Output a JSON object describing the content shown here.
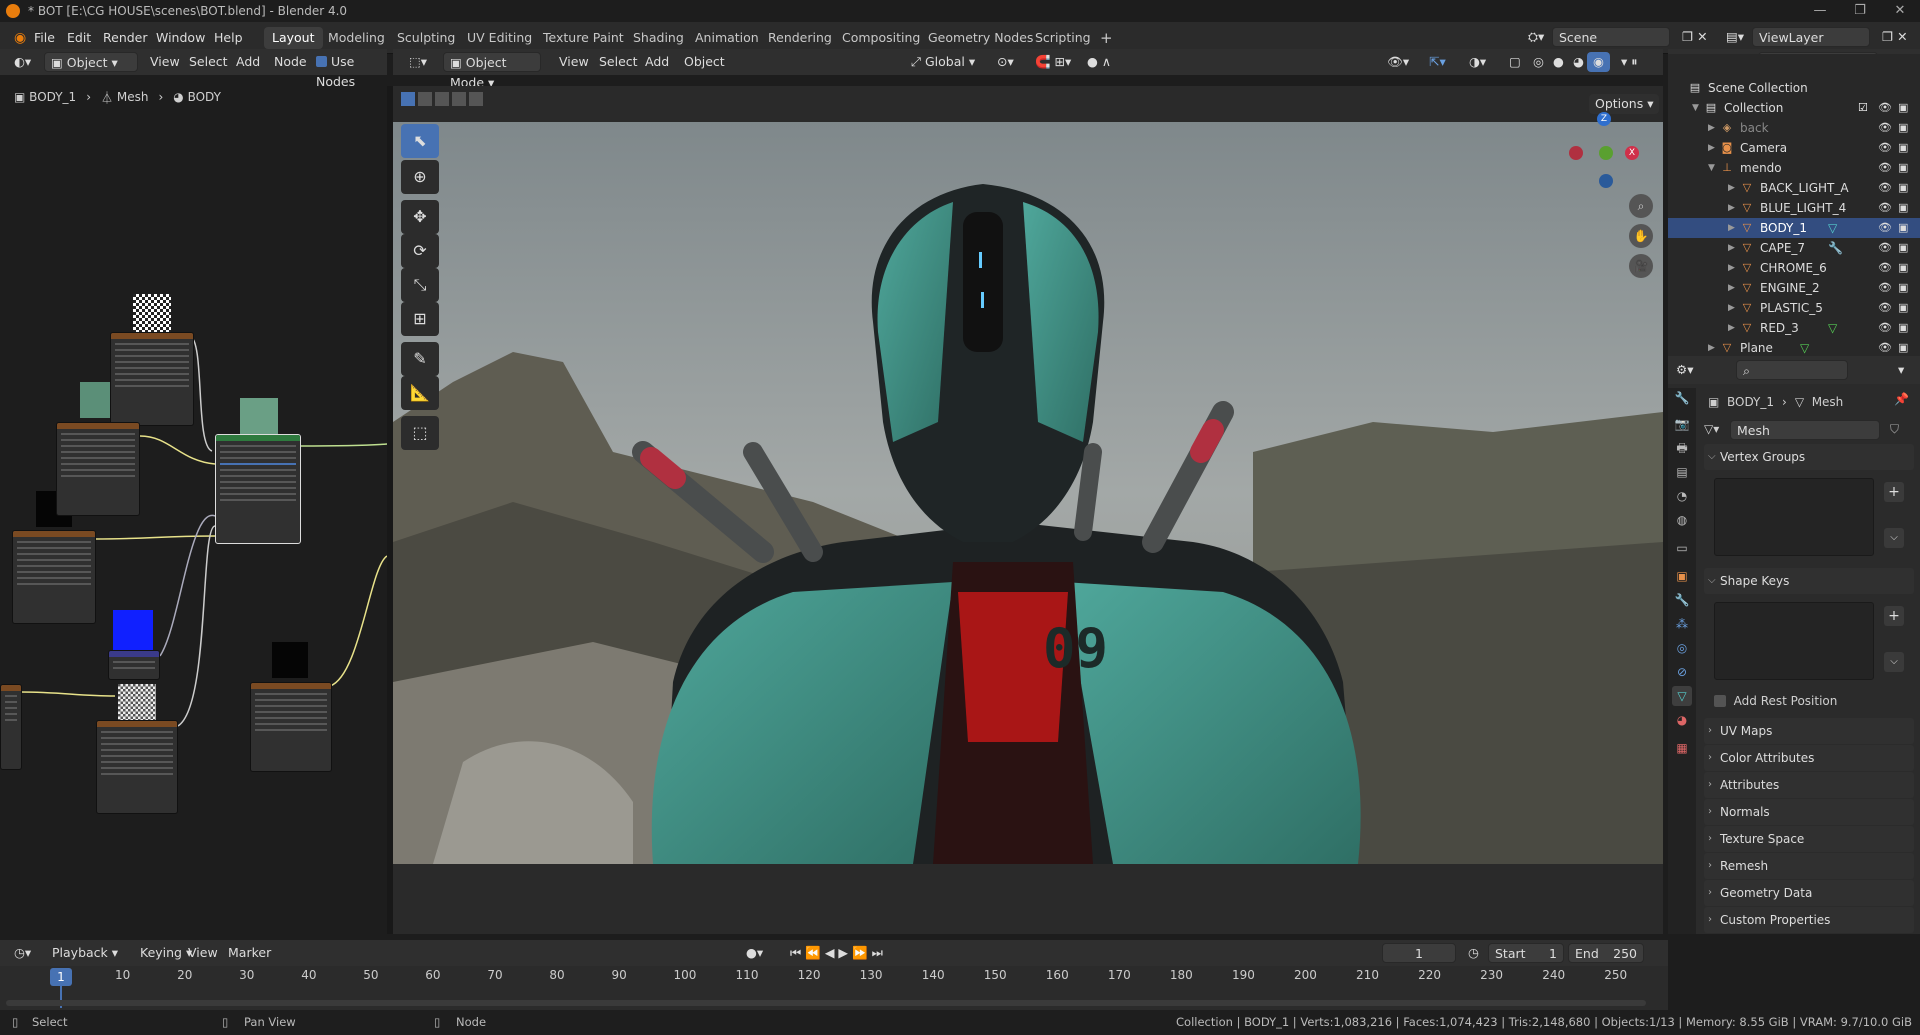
{
  "title": "* BOT [E:\\CG HOUSE\\scenes\\BOT.blend] - Blender 4.0",
  "menu": [
    "File",
    "Edit",
    "Render",
    "Window",
    "Help"
  ],
  "workspaces": [
    "Layout",
    "Modeling",
    "Sculpting",
    "UV Editing",
    "Texture Paint",
    "Shading",
    "Animation",
    "Rendering",
    "Compositing",
    "Geometry Nodes",
    "Scripting"
  ],
  "active_workspace": "Layout",
  "scene": "Scene",
  "view_layer": "ViewLayer",
  "node_editor": {
    "type_label": "Object",
    "menus": [
      "View",
      "Select",
      "Add",
      "Node"
    ],
    "use_nodes_label": "Use Nodes",
    "breadcrumb": [
      "BODY_1",
      "Mesh",
      "BODY"
    ]
  },
  "viewport": {
    "mode": "Object Mode",
    "menus": [
      "View",
      "Select",
      "Add",
      "Object"
    ],
    "orientation": "Global",
    "options_label": "Options"
  },
  "outliner": {
    "title": "Scene Collection",
    "items": [
      {
        "label": "Collection",
        "level": 0
      },
      {
        "label": "back",
        "level": 1
      },
      {
        "label": "Camera",
        "level": 1
      },
      {
        "label": "mendo",
        "level": 1
      },
      {
        "label": "BACK_LIGHT_A",
        "level": 2
      },
      {
        "label": "BLUE_LIGHT_4",
        "level": 2
      },
      {
        "label": "BODY_1",
        "level": 2
      },
      {
        "label": "CAPE_7",
        "level": 2
      },
      {
        "label": "CHROME_6",
        "level": 2
      },
      {
        "label": "ENGINE_2",
        "level": 2
      },
      {
        "label": "PLASTIC_5",
        "level": 2
      },
      {
        "label": "RED_3",
        "level": 2
      },
      {
        "label": "Plane",
        "level": 1
      }
    ]
  },
  "properties": {
    "breadcrumb": [
      "BODY_1",
      "Mesh"
    ],
    "data_name": "Mesh",
    "sections": [
      "Vertex Groups",
      "Shape Keys",
      "UV Maps",
      "Color Attributes",
      "Attributes",
      "Normals",
      "Texture Space",
      "Remesh",
      "Geometry Data",
      "Custom Properties"
    ],
    "add_rest_position": "Add Rest Position"
  },
  "timeline": {
    "menus": [
      "Playback",
      "Keying",
      "View",
      "Marker"
    ],
    "current_frame": "1",
    "start_label": "Start",
    "start": "1",
    "end_label": "End",
    "end": "250",
    "ticks": [
      "10",
      "20",
      "30",
      "40",
      "50",
      "60",
      "70",
      "80",
      "90",
      "100",
      "110",
      "120",
      "130",
      "140",
      "150",
      "160",
      "170",
      "180",
      "190",
      "200",
      "210",
      "220",
      "230",
      "240",
      "250"
    ]
  },
  "status": {
    "left": [
      "Select",
      "Pan View",
      "Node"
    ],
    "right": "Collection | BODY_1 | Verts:1,083,216 | Faces:1,074,423 | Tris:2,148,680 | Objects:1/13 | Memory: 8.55 GiB | VRAM: 9.7/10.0 GiB"
  }
}
